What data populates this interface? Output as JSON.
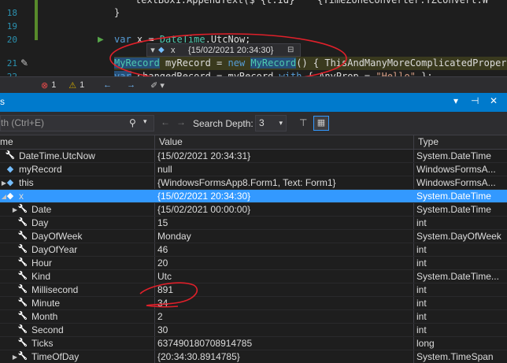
{
  "editor": {
    "lines": [
      {
        "num": "18",
        "text": "}"
      },
      {
        "num": "19",
        "text": ""
      },
      {
        "num": "20",
        "text": "var x = DateTime.UtcNow;"
      },
      {
        "num": "21",
        "text": "MyRecord myRecord = new MyRecord() { ThisAndManyMoreComplicatedPropertie"
      },
      {
        "num": "22",
        "text": "var changedRecord = myRecord with { AnyProp = \"Hello\" };"
      }
    ],
    "top_partial": "textBox1.AppendText($\"{t.Id}\t{TimeZoneConverter.TZConvert.W"
  },
  "datatip": {
    "name": "x",
    "value": "{15/02/2021 20:34:30}"
  },
  "edstrip": {
    "errors": "1",
    "warnings": "1"
  },
  "locals": {
    "title": "s",
    "search_placeholder": "th (Ctrl+E)",
    "search_depth_label": "Search Depth:",
    "search_depth_value": "3",
    "columns": {
      "name": "me",
      "value": "Value",
      "type": "Type"
    },
    "rows": [
      {
        "name": "DateTime.UtcNow",
        "value": "{15/02/2021 20:34:31}",
        "type": "System.DateTime"
      },
      {
        "name": "myRecord",
        "value": "null",
        "type": "WindowsFormsA..."
      },
      {
        "name": "this",
        "value": "{WindowsFormsApp8.Form1, Text: Form1}",
        "type": "WindowsFormsA..."
      },
      {
        "name": "x",
        "value": "{15/02/2021 20:34:30}",
        "type": "System.DateTime"
      },
      {
        "name": "Date",
        "value": "{15/02/2021 00:00:00}",
        "type": "System.DateTime"
      },
      {
        "name": "Day",
        "value": "15",
        "type": "int"
      },
      {
        "name": "DayOfWeek",
        "value": "Monday",
        "type": "System.DayOfWeek"
      },
      {
        "name": "DayOfYear",
        "value": "46",
        "type": "int"
      },
      {
        "name": "Hour",
        "value": "20",
        "type": "int"
      },
      {
        "name": "Kind",
        "value": "Utc",
        "type": "System.DateTime..."
      },
      {
        "name": "Millisecond",
        "value": "891",
        "type": "int"
      },
      {
        "name": "Minute",
        "value": "34",
        "type": "int"
      },
      {
        "name": "Month",
        "value": "2",
        "type": "int"
      },
      {
        "name": "Second",
        "value": "30",
        "type": "int"
      },
      {
        "name": "Ticks",
        "value": "637490180708914785",
        "type": "long"
      },
      {
        "name": "TimeOfDay",
        "value": "{20:34:30.8914785}",
        "type": "System.TimeSpan"
      }
    ]
  },
  "colors": {
    "selection": "#3399ff",
    "title_bar": "#007acc",
    "annotation": "#e0202a"
  }
}
